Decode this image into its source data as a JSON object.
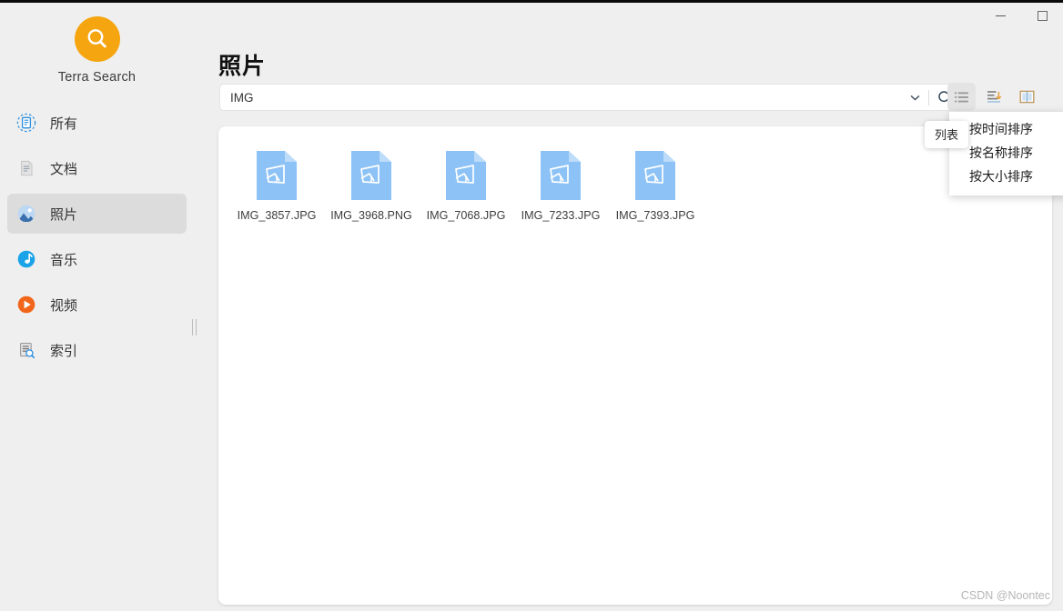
{
  "window": {
    "minimize_label": "Minimize",
    "maximize_label": "Maximize"
  },
  "sidebar": {
    "brand": "Terra Search",
    "logo_icon": "search-circle-icon",
    "logo_color": "#f5a510",
    "items": [
      {
        "label": "所有",
        "icon": "all-files-icon",
        "active": false
      },
      {
        "label": "文档",
        "icon": "document-icon",
        "active": false
      },
      {
        "label": "照片",
        "icon": "photo-icon",
        "active": true
      },
      {
        "label": "音乐",
        "icon": "music-icon",
        "active": false
      },
      {
        "label": "视频",
        "icon": "video-icon",
        "active": false
      },
      {
        "label": "索引",
        "icon": "index-icon",
        "active": false
      }
    ]
  },
  "main": {
    "title": "照片",
    "search": {
      "value": "IMG",
      "placeholder": "",
      "chevron_icon": "chevron-down-icon",
      "search_icon": "search-icon"
    },
    "toolbar": [
      {
        "name": "list-view-button",
        "icon": "list-icon",
        "active": true,
        "tooltip": "列表"
      },
      {
        "name": "sort-button",
        "icon": "sort-desc-icon",
        "active": false,
        "tooltip": ""
      },
      {
        "name": "split-view-button",
        "icon": "columns-icon",
        "active": false,
        "tooltip": ""
      }
    ],
    "tooltip_text": "列表",
    "sort_menu": [
      "按时间排序",
      "按名称排序",
      "按大小排序"
    ],
    "files": [
      {
        "name": "IMG_3857.JPG",
        "icon": "image-file-icon"
      },
      {
        "name": "IMG_3968.PNG",
        "icon": "image-file-icon"
      },
      {
        "name": "IMG_7068.JPG",
        "icon": "image-file-icon"
      },
      {
        "name": "IMG_7233.JPG",
        "icon": "image-file-icon"
      },
      {
        "name": "IMG_7393.JPG",
        "icon": "image-file-icon"
      }
    ]
  },
  "watermark": "CSDN @Noontec",
  "colors": {
    "accent": "#f5a510",
    "file_icon": "#8cc2f5",
    "window_bg": "#efefef",
    "card_bg": "#ffffff"
  }
}
